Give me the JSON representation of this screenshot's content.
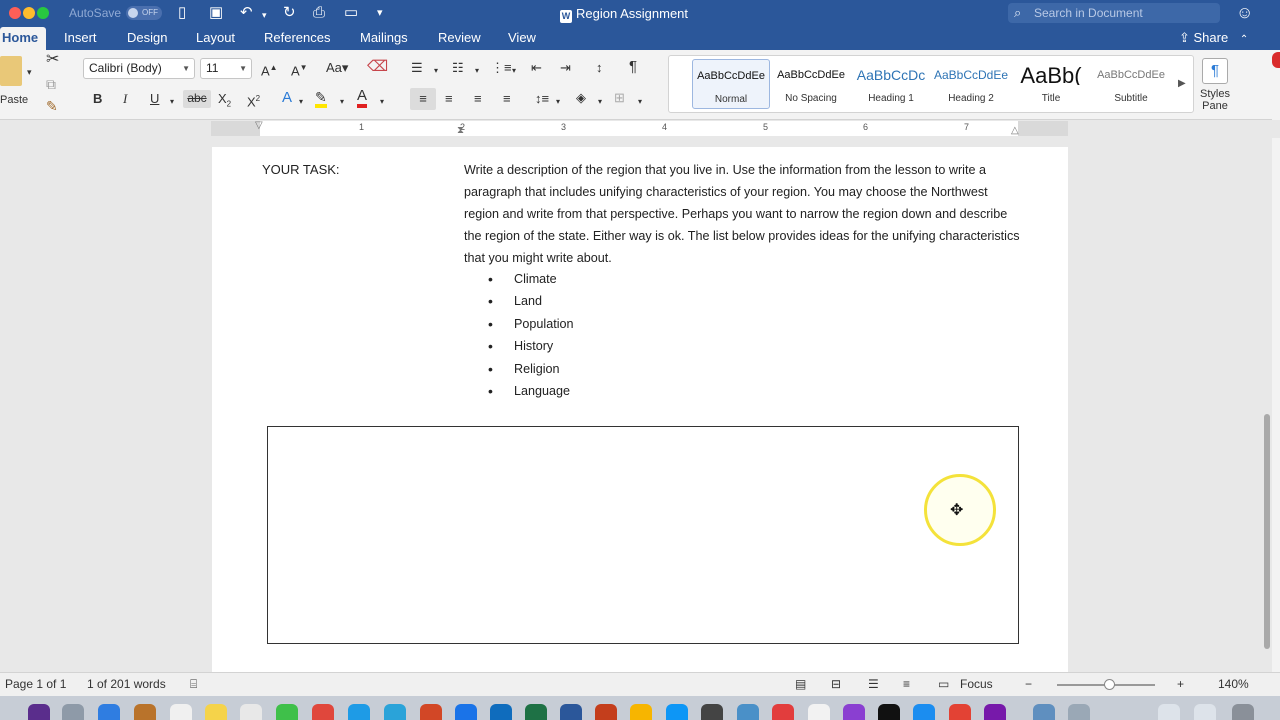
{
  "window": {
    "title": "Region Assignment",
    "autosave_label": "AutoSave",
    "autosave_state": "OFF",
    "search_placeholder": "Search in Document"
  },
  "tabs": [
    {
      "label": "Home",
      "active": true
    },
    {
      "label": "Insert"
    },
    {
      "label": "Design"
    },
    {
      "label": "Layout"
    },
    {
      "label": "References"
    },
    {
      "label": "Mailings"
    },
    {
      "label": "Review"
    },
    {
      "label": "View"
    }
  ],
  "share_label": "Share",
  "ribbon": {
    "paste_label": "Paste",
    "font_name": "Calibri (Body)",
    "font_size": "11",
    "bold": "B",
    "italic": "I",
    "underline": "U",
    "strike": "abc",
    "styles": [
      {
        "sample": "AaBbCcDdEe",
        "name": "Normal",
        "selected": true
      },
      {
        "sample": "AaBbCcDdEe",
        "name": "No Spacing"
      },
      {
        "sample": "AaBbCcDc",
        "name": "Heading 1"
      },
      {
        "sample": "AaBbCcDdEe",
        "name": "Heading 2"
      },
      {
        "sample": "AaBb(",
        "name": "Title"
      },
      {
        "sample": "AaBbCcDdEe",
        "name": "Subtitle"
      }
    ],
    "styles_pane_label": "Styles Pane"
  },
  "ruler": {
    "numbers": [
      "1",
      "2",
      "3",
      "4",
      "5",
      "6",
      "7"
    ]
  },
  "document": {
    "task_label": "YOUR TASK:",
    "paragraph": "Write a description of the region that you live in.  Use the information from the lesson to write a paragraph that includes unifying characteristics of your region.   You may choose the Northwest region and write from that perspective.  Perhaps you want to narrow the region down and describe the region of the state.  Either way is ok.  The list below provides ideas for the unifying characteristics that you might write about.",
    "bullets": [
      "Climate",
      "Land",
      "Population",
      "History",
      "Religion",
      "Language"
    ]
  },
  "status": {
    "page": "Page 1 of 1",
    "words": "1 of 201 words",
    "focus": "Focus",
    "zoom": "140%"
  },
  "colors": {
    "accent": "#2b579a",
    "ribbon_bg": "#f3f3f3",
    "highlight": "#f4e23a"
  }
}
